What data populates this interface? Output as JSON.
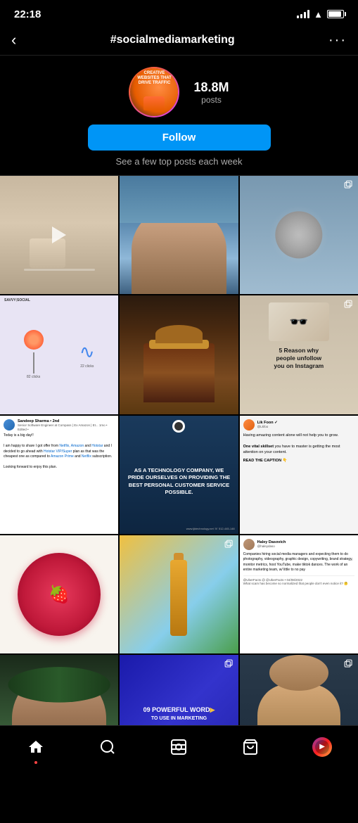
{
  "statusBar": {
    "time": "22:18"
  },
  "topNav": {
    "backIcon": "‹",
    "title": "#socialmediamarketing",
    "moreIcon": "···"
  },
  "profileHeader": {
    "postsCount": "18.8M",
    "postsLabel": "posts",
    "followButton": "Follow",
    "subtext": "See a few top posts each week"
  },
  "grid": {
    "posts": [
      {
        "id": 1,
        "type": "image",
        "indicator": "video"
      },
      {
        "id": 2,
        "type": "image",
        "indicator": "none"
      },
      {
        "id": 3,
        "type": "image",
        "indicator": "multi"
      },
      {
        "id": 4,
        "type": "lollipop",
        "indicator": "none"
      },
      {
        "id": 5,
        "type": "cake",
        "indicator": "none"
      },
      {
        "id": 6,
        "type": "reason",
        "indicator": "multi",
        "text": "5 Reason why people unfollow you on Instagram"
      },
      {
        "id": 7,
        "type": "linkedin",
        "indicator": "none",
        "authorName": "Sandeep Sharma",
        "authorTitle": "2nd Senior Software Engineer at Compass | Ex Amazon | Et... 1mo • Edited •",
        "body": "Today is a big day!!\n\nI am happy to share I got offer from Netflix, Amazon and Hotstar and I decided to go ahead with Hotstar VIP/Super plan as that was the cheapest one as compared to Amazon Prime and Netflix subscription.\n\nLooking forward to enjoy this plan."
      },
      {
        "id": 8,
        "type": "tech",
        "indicator": "none",
        "text": "AS A TECHNOLOGY COMPANY, WE PRIDE OURSELVES ON PROVIDING THE BEST PERSONAL CUSTOMER SERVICE POSSIBLE."
      },
      {
        "id": 9,
        "type": "likfoon",
        "indicator": "none",
        "authorName": "Lik Foon",
        "authorHandle": "@Lkfoo",
        "body": "Having amazing content alone will not help you to grow.\n\nOne vital skillset you have to master is getting the most attention on your content.",
        "cta": "READ THE CAPTION 👇"
      },
      {
        "id": 10,
        "type": "raspberry",
        "indicator": "none"
      },
      {
        "id": 11,
        "type": "bottle",
        "indicator": "multi"
      },
      {
        "id": 12,
        "type": "haley",
        "indicator": "none",
        "authorName": "Haley Dasovich",
        "authorHandle": "@haleydaso",
        "body": "Companies hiring social media managers and expecting them to do photography, videography, graphic design, copywriting, brand strategy, monitor metrics, host YouTube, make tiktok dances. The work of an entire marketing team, w/ little to no pay",
        "footer": "@UberFacts @ @UberFacts • 04/08/2022\nWhat scam has become so normalized that people don't even notice it? 🤔"
      },
      {
        "id": 13,
        "type": "woman",
        "indicator": "none"
      },
      {
        "id": 14,
        "type": "marketing",
        "indicator": "multi",
        "text": "09 POWERFUL WORD",
        "arrow": "▶",
        "subtext": "TO USE IN MARKETING"
      },
      {
        "id": 15,
        "type": "man",
        "indicator": "multi"
      }
    ]
  },
  "bottomNav": {
    "homeLabel": "home",
    "searchLabel": "search",
    "reelsLabel": "reels",
    "shopLabel": "shop",
    "profileLabel": "profile"
  }
}
